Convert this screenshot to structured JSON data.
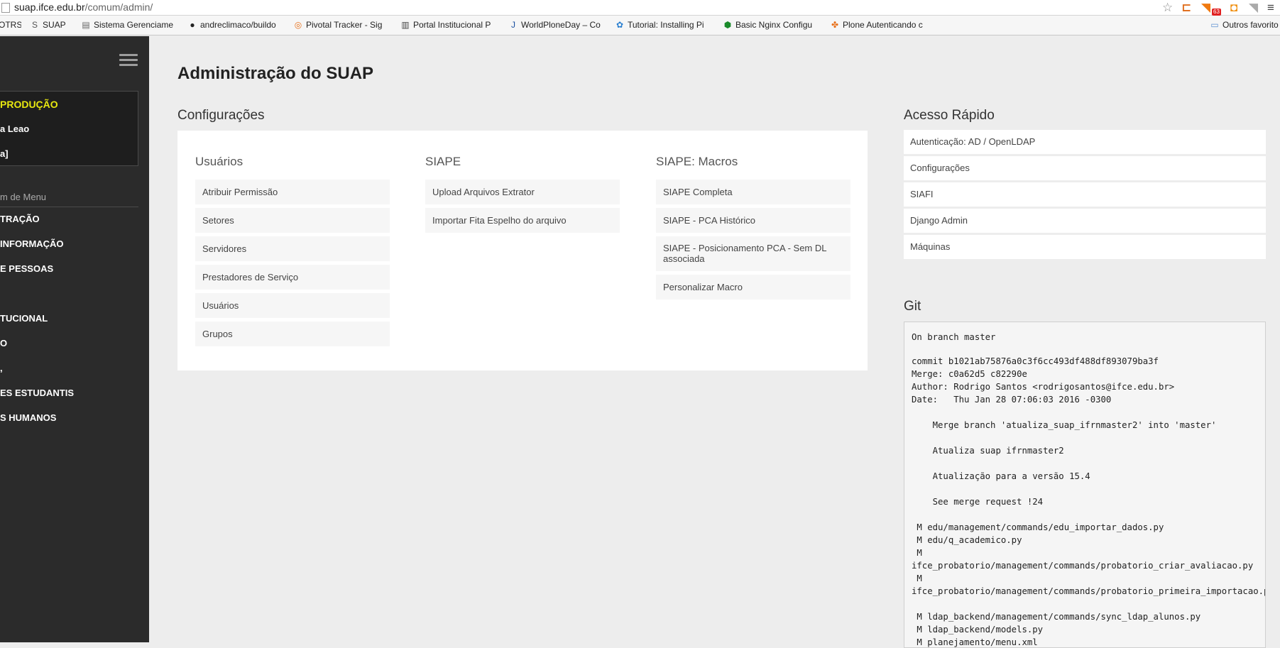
{
  "browser": {
    "url_host": "suap.ifce.edu.br",
    "url_path": "/comum/admin/",
    "rss_count": "63",
    "bookmarks": [
      {
        "label": "OTRS",
        "icon": "otrs-icon"
      },
      {
        "label": "SUAP",
        "icon": "suap-icon"
      },
      {
        "label": "Sistema Gerenciame",
        "icon": "sistema-icon"
      },
      {
        "label": "andreclimaco/buildo",
        "icon": "github-icon"
      },
      {
        "label": "Pivotal Tracker - Sig",
        "icon": "pivotal-icon"
      },
      {
        "label": "Portal Institucional P",
        "icon": "portal-icon"
      },
      {
        "label": "WorldPloneDay – Co",
        "icon": "wpd-icon"
      },
      {
        "label": "Tutorial: Installing Pi",
        "icon": "tutorial-icon"
      },
      {
        "label": "Basic Nginx Configu",
        "icon": "nginx-icon"
      },
      {
        "label": "Plone Autenticando c",
        "icon": "plone-icon"
      }
    ],
    "other_bookmarks": "Outros favorito"
  },
  "sidebar": {
    "environment": "PRODUÇÃO",
    "user_name": "a Leao",
    "user_extra": "a]",
    "menu_search": "m de Menu",
    "items": [
      {
        "label": "TRAÇÃO"
      },
      {
        "label": "INFORMAÇÃO"
      },
      {
        "label": "E PESSOAS"
      },
      {
        "label": ""
      },
      {
        "label": "TUCIONAL"
      },
      {
        "label": "O"
      },
      {
        "label": ","
      },
      {
        "label": "ES ESTUDANTIS"
      },
      {
        "label": "S HUMANOS"
      }
    ]
  },
  "main": {
    "title": "Administração do SUAP",
    "config": {
      "title": "Configurações",
      "columns": [
        {
          "title": "Usuários",
          "links": [
            "Atribuir Permissão",
            "Setores",
            "Servidores",
            "Prestadores de Serviço",
            "Usuários",
            "Grupos"
          ]
        },
        {
          "title": "SIAPE",
          "links": [
            "Upload Arquivos Extrator",
            "Importar Fita Espelho do arquivo"
          ]
        },
        {
          "title": "SIAPE: Macros",
          "links": [
            "SIAPE Completa",
            "SIAPE - PCA Histórico",
            "SIAPE - Posicionamento PCA - Sem DL associada",
            "Personalizar Macro"
          ]
        }
      ]
    },
    "quick_access": {
      "title": "Acesso Rápido",
      "items": [
        "Autenticação: AD / OpenLDAP",
        "Configurações",
        "SIAFI",
        "Django Admin",
        "Máquinas"
      ]
    },
    "git": {
      "title": "Git",
      "lines": [
        "On branch master",
        "",
        "commit b1021ab75876a0c3f6cc493df488df893079ba3f",
        "Merge: c0a62d5 c82290e",
        "Author: Rodrigo Santos <rodrigosantos@ifce.edu.br>",
        "Date:   Thu Jan 28 07:06:03 2016 -0300",
        "",
        "    Merge branch 'atualiza_suap_ifrnmaster2' into 'master'",
        "",
        "    Atualiza suap ifrnmaster2",
        "",
        "    Atualização para a versão 15.4",
        "",
        "    See merge request !24",
        "",
        " M edu/management/commands/edu_importar_dados.py",
        " M edu/q_academico.py",
        " M",
        "ifce_probatorio/management/commands/probatorio_criar_avaliacao.py",
        " M",
        "ifce_probatorio/management/commands/probatorio_primeira_importacao.py",
        "",
        " M ldap_backend/management/commands/sync_ldap_alunos.py",
        " M ldap_backend/models.py",
        " M planejamento/menu.xml"
      ]
    }
  }
}
